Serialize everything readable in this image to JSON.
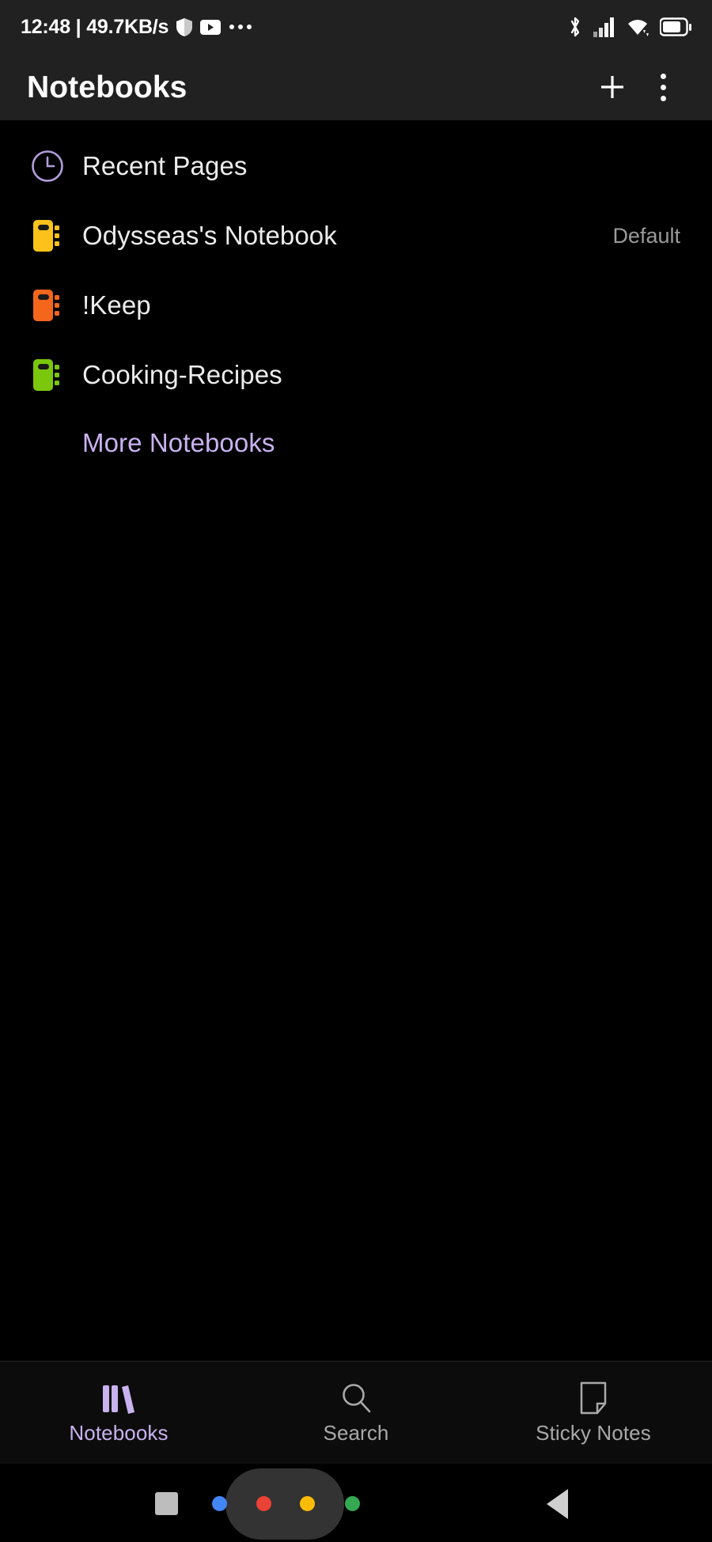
{
  "status_bar": {
    "clock_text": "12:48 | 49.7KB/s",
    "left_icons": [
      "shield-icon",
      "youtube-icon",
      "more-dots-icon"
    ],
    "right_icons": [
      "bluetooth-icon",
      "cellular-signal-icon",
      "wifi-icon",
      "battery-icon"
    ],
    "battery_level": "75%",
    "background": "#212121"
  },
  "app_bar": {
    "title": "Notebooks",
    "add_button_label": "+",
    "overflow_button_label": "⋮",
    "background": "#212121"
  },
  "notebooks": {
    "items": [
      {
        "label": "Recent Pages",
        "icon": "clock-icon",
        "color": "#b39ddb",
        "badge": ""
      },
      {
        "label": "Odysseas's Notebook",
        "icon": "notebook-icon",
        "color": "#fcc21b",
        "badge": "Default"
      },
      {
        "label": "!Keep",
        "icon": "notebook-icon",
        "color": "#f4661b",
        "badge": ""
      },
      {
        "label": "Cooking-Recipes",
        "icon": "notebook-icon",
        "color": "#7ac70c",
        "badge": ""
      }
    ],
    "more_label": "More Notebooks",
    "more_color": "#c9b2f0"
  },
  "bottom_nav": {
    "active_index": 0,
    "active_color": "#c9b2f0",
    "inactive_color": "#a9a9a9",
    "items": [
      {
        "label": "Notebooks",
        "icon": "books-icon"
      },
      {
        "label": "Search",
        "icon": "search-icon"
      },
      {
        "label": "Sticky Notes",
        "icon": "sticky-note-icon"
      }
    ]
  },
  "system_nav": {
    "recents_label": "recents-square",
    "back_label": "back-triangle",
    "assistant_dots": [
      "#4285f4",
      "#ea4335",
      "#fbbc05",
      "#34a853"
    ]
  }
}
